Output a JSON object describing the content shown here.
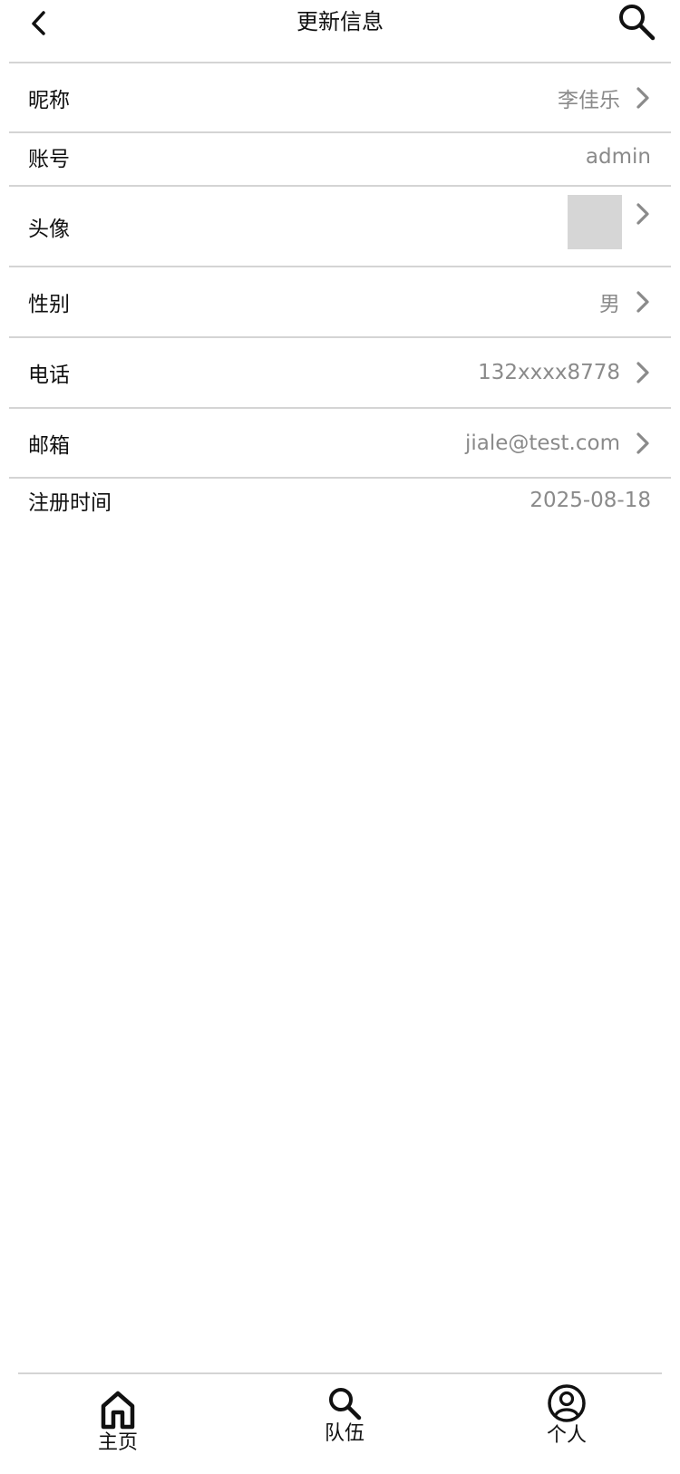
{
  "header": {
    "title": "更新信息",
    "back_icon": "chevron-left-icon",
    "search_icon": "search-icon"
  },
  "profile": {
    "nickname": {
      "label": "昵称",
      "value": "李佳乐"
    },
    "account": {
      "label": "账号",
      "value": "admin"
    },
    "avatar": {
      "label": "头像"
    },
    "gender": {
      "label": "性别",
      "value": "男"
    },
    "phone": {
      "label": "电话",
      "value": "132xxxx8778"
    },
    "email": {
      "label": "邮箱",
      "value": "jiale@test.com"
    },
    "registered": {
      "label": "注册时间",
      "value": "2025-08-18"
    }
  },
  "tabbar": {
    "items": [
      {
        "label": "主页",
        "icon": "home-icon"
      },
      {
        "label": "队伍",
        "icon": "search-icon"
      },
      {
        "label": "个人",
        "icon": "user-circle-icon"
      }
    ]
  },
  "colors": {
    "divider": "#d4d4d4",
    "value_text": "#8a8a8a",
    "avatar_placeholder": "#d6d6d6",
    "text": "#111111"
  }
}
